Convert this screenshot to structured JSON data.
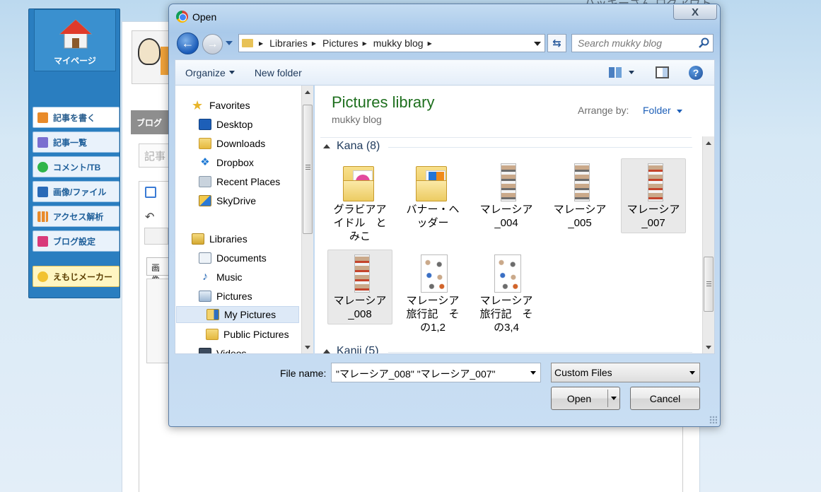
{
  "background_page": {
    "top_right_text": "ハッキーさん ログアウト",
    "mypage_label": "マイページ",
    "nav": [
      {
        "label": "記事を書く",
        "icon": "pencil-icon",
        "color": "#e98b2a"
      },
      {
        "label": "記事一覧",
        "icon": "document-icon",
        "color": "#7a6fd0"
      },
      {
        "label": "コメント/TB",
        "icon": "speech-bubble-icon",
        "color": "#2fb54a"
      },
      {
        "label": "画像/ファイル",
        "icon": "image-icon",
        "color": "#2a6ab7"
      },
      {
        "label": "アクセス解析",
        "icon": "bar-chart-icon",
        "color": "#e98b2a"
      },
      {
        "label": "ブログ設定",
        "icon": "wrench-icon",
        "color": "#d93a7a"
      }
    ],
    "emoji_maker_label": "えもじメーカー",
    "gray_tab_label": "ブログ",
    "title_box_placeholder": "記事",
    "editor_label": "画像"
  },
  "dialog": {
    "title": "Open",
    "close_glyph": "X",
    "address": {
      "crumbs": [
        "Libraries",
        "Pictures",
        "mukky blog"
      ]
    },
    "search": {
      "placeholder": "Search mukky blog"
    },
    "commandbar": {
      "organize_label": "Organize",
      "new_folder_label": "New folder"
    },
    "navigation": {
      "items": [
        {
          "label": "Favorites",
          "icon": "star-icon"
        },
        {
          "label": "Desktop",
          "icon": "desktop-icon"
        },
        {
          "label": "Downloads",
          "icon": "downloads-folder-icon"
        },
        {
          "label": "Dropbox",
          "icon": "dropbox-icon"
        },
        {
          "label": "Recent Places",
          "icon": "recent-places-icon"
        },
        {
          "label": "SkyDrive",
          "icon": "skydrive-icon"
        },
        {
          "label": "Libraries",
          "icon": "libraries-icon"
        },
        {
          "label": "Documents",
          "icon": "documents-icon"
        },
        {
          "label": "Music",
          "icon": "music-icon"
        },
        {
          "label": "Pictures",
          "icon": "pictures-icon"
        },
        {
          "label": "My Pictures",
          "icon": "my-pictures-icon"
        },
        {
          "label": "Public Pictures",
          "icon": "public-pictures-icon"
        },
        {
          "label": "Videos",
          "icon": "videos-icon"
        }
      ],
      "selected": "My Pictures"
    },
    "content": {
      "library_title": "Pictures library",
      "library_subtitle": "mukky blog",
      "arrange_by_label": "Arrange by:",
      "arrange_by_value": "Folder",
      "groups": [
        {
          "header": "Kana (8)",
          "items": [
            {
              "label": "グラビアア\nイドル　と\nみこ",
              "kind": "folder",
              "selected": false
            },
            {
              "label": "バナー・ヘ\nッダー",
              "kind": "folder",
              "selected": false
            },
            {
              "label": "マレーシア\n_004",
              "kind": "image",
              "selected": false
            },
            {
              "label": "マレーシア\n_005",
              "kind": "image",
              "selected": false
            },
            {
              "label": "マレーシア\n_007",
              "kind": "image",
              "selected": true
            },
            {
              "label": "マレーシア\n_008",
              "kind": "image",
              "selected": true
            },
            {
              "label": "マレーシア\n旅行記　そ\nの1,2",
              "kind": "image",
              "selected": false
            },
            {
              "label": "マレーシア\n旅行記　そ\nの3,4",
              "kind": "image",
              "selected": false
            }
          ]
        },
        {
          "header": "Kanji (5)",
          "items": []
        }
      ]
    },
    "file_name_label": "File name:",
    "file_name_value": "\"マレーシア_008\" \"マレーシア_007\"",
    "file_type_value": "Custom Files",
    "open_label": "Open",
    "cancel_label": "Cancel"
  }
}
